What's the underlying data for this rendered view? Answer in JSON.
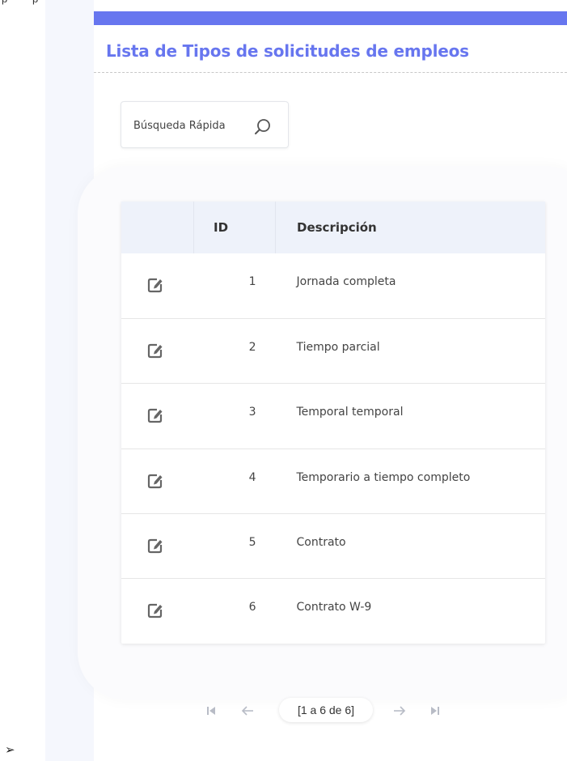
{
  "page": {
    "title": "Lista de Tipos de solicitudes de empleos"
  },
  "search": {
    "placeholder": "Búsqueda Rápida"
  },
  "table": {
    "headers": {
      "action": "",
      "id": "ID",
      "description": "Descripción"
    },
    "rows": [
      {
        "id": "1",
        "description": "Jornada completa"
      },
      {
        "id": "2",
        "description": "Tiempo parcial"
      },
      {
        "id": "3",
        "description": "Temporal temporal"
      },
      {
        "id": "4",
        "description": "Temporario a tiempo completo"
      },
      {
        "id": "5",
        "description": "Contrato"
      },
      {
        "id": "6",
        "description": "Contrato W-9"
      }
    ]
  },
  "pagination": {
    "label": "[1 a 6 de 6]"
  },
  "icons": {
    "search": "search-icon",
    "edit": "edit-icon",
    "first": "first-page-icon",
    "prev": "arrow-left-icon",
    "next": "arrow-right-icon",
    "last": "last-page-icon"
  },
  "colors": {
    "accent": "#6776ef",
    "header_bg": "#eef2fa",
    "sidebar_bg": "#f5f7fd",
    "pager_icon": "#b8bcc6"
  }
}
